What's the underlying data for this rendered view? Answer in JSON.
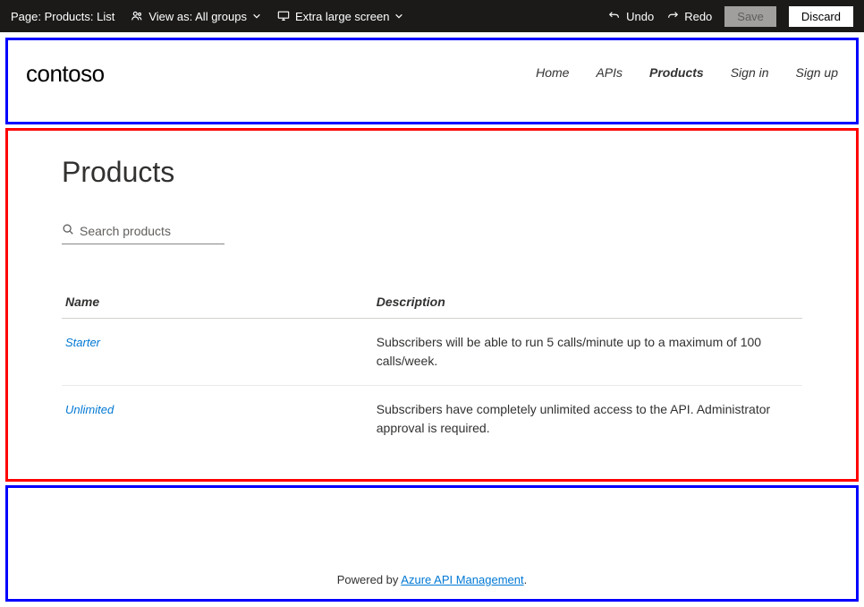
{
  "toolbar": {
    "pageLabel": "Page: Products: List",
    "viewAsLabel": "View as: All groups",
    "screenLabel": "Extra large screen",
    "undoLabel": "Undo",
    "redoLabel": "Redo",
    "saveLabel": "Save",
    "discardLabel": "Discard"
  },
  "header": {
    "brand": "contoso",
    "nav": {
      "home": "Home",
      "apis": "APIs",
      "products": "Products",
      "signin": "Sign in",
      "signup": "Sign up"
    }
  },
  "content": {
    "title": "Products",
    "searchPlaceholder": "Search products",
    "columns": {
      "name": "Name",
      "description": "Description"
    },
    "rows": [
      {
        "name": "Starter",
        "description": "Subscribers will be able to run 5 calls/minute up to a maximum of 100 calls/week."
      },
      {
        "name": "Unlimited",
        "description": "Subscribers have completely unlimited access to the API. Administrator approval is required."
      }
    ]
  },
  "footer": {
    "prefix": "Powered by ",
    "linkText": "Azure API Management",
    "suffix": "."
  }
}
